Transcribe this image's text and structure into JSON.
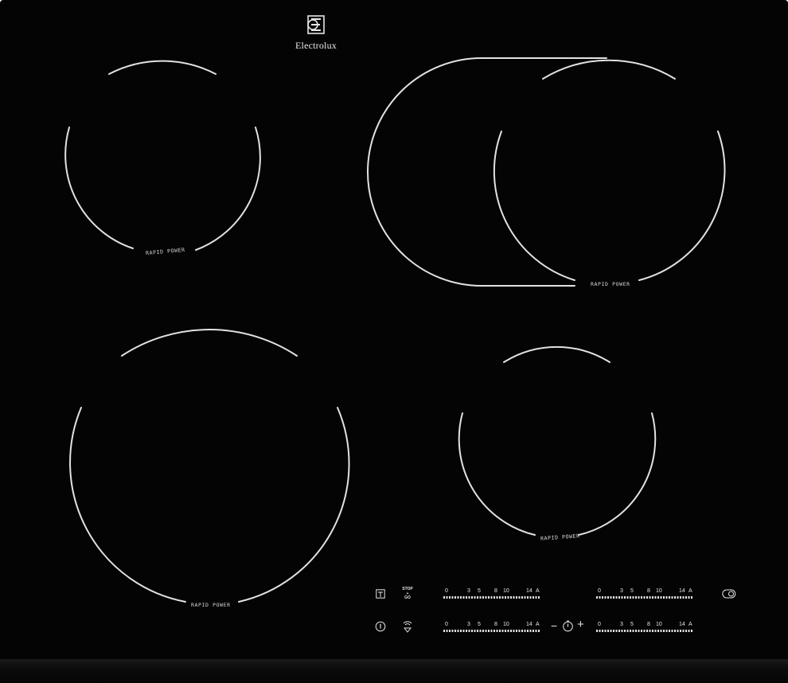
{
  "brand": {
    "name": "Electrolux",
    "logo_icon": "electrolux-logo-icon"
  },
  "zones": {
    "front_left_label": "RAPID POWER",
    "front_right_label": "RAPID POWER",
    "rear_left_label": "RAPID POWER",
    "rear_right_label": "RAPID POWER"
  },
  "controls": {
    "lock_icon": "child-lock-icon",
    "stop_go": {
      "line1": "STOP",
      "line2": "+",
      "line3": "GO"
    },
    "power_icon": "power-icon",
    "bridge_icon": "bridge-zone-icon",
    "timer": {
      "minus": "−",
      "plus": "+",
      "icon": "timer-icon"
    },
    "dual_zone_icon": "dual-zone-toggle-icon",
    "slider_scale": [
      "0",
      "3",
      "5",
      "8",
      "10",
      "14",
      "A"
    ]
  },
  "colors": {
    "glass": "#040404",
    "print": "#e6e6e6"
  }
}
